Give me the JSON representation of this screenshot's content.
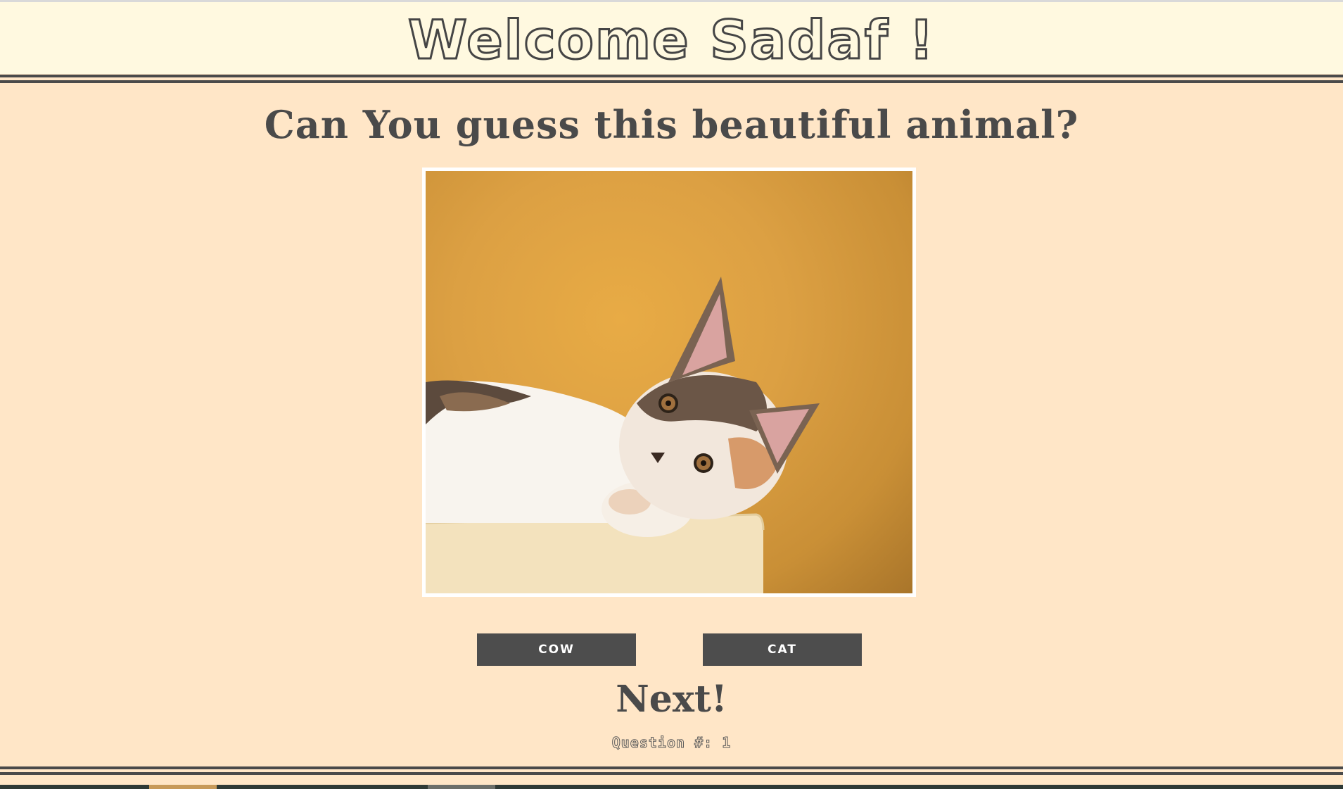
{
  "header": {
    "title": "Welcome Sadaf !"
  },
  "question": {
    "text": "Can You guess this beautiful animal?"
  },
  "image": {
    "subject": "kitten-photo"
  },
  "answers": [
    {
      "label": "COW"
    },
    {
      "label": "CAT"
    }
  ],
  "next": {
    "label": "Next!"
  },
  "counter": {
    "text": "Question #: 1"
  },
  "colors": {
    "page_bg": "#ffe6c7",
    "header_bg": "#fff9e0",
    "text": "#4a4a4a",
    "button_bg": "#4d4d4d",
    "button_text": "#ffffff"
  }
}
